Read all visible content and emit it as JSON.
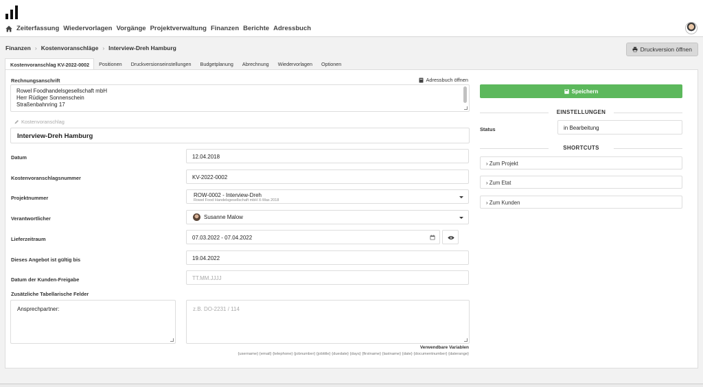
{
  "nav": {
    "items": [
      "Zeiterfassung",
      "Wiedervorlagen",
      "Vorgänge",
      "Projektverwaltung",
      "Finanzen",
      "Berichte",
      "Adressbuch"
    ]
  },
  "breadcrumb": [
    "Finanzen",
    "Kostenvoranschläge",
    "Interview-Dreh Hamburg"
  ],
  "print_button": "Druckversion öffnen",
  "tabs": [
    "Kostenvoranschlag KV-2022-0002",
    "Positionen",
    "Druckversionseinstellungen",
    "Budgetplanung",
    "Abrechnung",
    "Wiedervorlagen",
    "Optionen"
  ],
  "form": {
    "billing_label": "Rechnungsanschrift",
    "addressbook_link": "Adressbuch öffnen",
    "billing_lines": [
      "Rowel Foodhandelsgesellschaft mbH",
      "Herr Rüdiger Sonnenschein",
      "Straßenbahnring 17"
    ],
    "kv_label": "Kostenvoranschlag",
    "kv_title": "Interview-Dreh Hamburg",
    "date_label": "Datum",
    "date_value": "12.04.2018",
    "number_label": "Kostenvoranschlagsnummer",
    "number_value": "KV-2022-0002",
    "project_label": "Projektnummer",
    "project_value": "ROW-0002 - Interview-Dreh",
    "project_sub": "Rowel Food Handelsgesellschaft mbH X-Mas 2018",
    "responsible_label": "Verantwortlicher",
    "responsible_value": "Susanne Malow",
    "delivery_label": "Lieferzeitraum",
    "delivery_value": "07.03.2022 - 07.04.2022",
    "valid_label": "Dieses Angebot ist gültig bis",
    "valid_value": "19.04.2022",
    "approval_label": "Datum der Kunden-Freigabe",
    "approval_placeholder": "TT.MM.JJJJ",
    "extra_label": "Zusätzliche Tabellarische Felder",
    "extra_key": "Ansprechpartner:",
    "extra_placeholder": "z.B. DO-2231 / 114",
    "vars_title": "Verwendbare Variablen",
    "vars": "{username} {email} {telephone} {jobnumber} {jobtitle} {duedate} {days} {firstname} {lastname} {date} {documentnumber} {daterange}"
  },
  "sidebar": {
    "save": "Speichern",
    "settings_heading": "EINSTELLUNGEN",
    "status_label": "Status",
    "status_value": "in Bearbeitung",
    "shortcuts_heading": "SHORTCUTS",
    "shortcuts": [
      "Zum Projekt",
      "Zum Etat",
      "Zum Kunden"
    ]
  },
  "colors": {
    "save": "#5cb85c",
    "accent_bg": "#f2f2f2"
  }
}
